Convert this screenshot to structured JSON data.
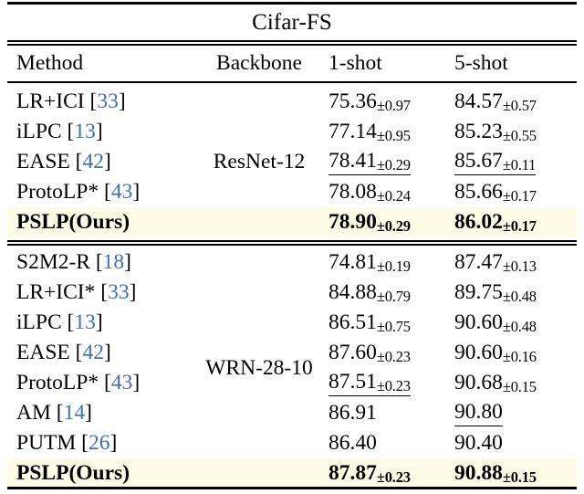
{
  "table": {
    "title": "Cifar-FS",
    "columns": {
      "method": "Method",
      "backbone": "Backbone",
      "one_shot": "1-shot",
      "five_shot": "5-shot"
    },
    "groups": [
      {
        "backbone": "ResNet-12",
        "rows": [
          {
            "method": "LR+ICI",
            "citation": "33",
            "one_shot": "75.36",
            "one_shot_pm": "±0.97",
            "five_shot": "84.57",
            "five_shot_pm": "±0.57",
            "bold": false,
            "highlight": false,
            "one_shot_underline": false,
            "five_shot_underline": false
          },
          {
            "method": "iLPC",
            "citation": "13",
            "one_shot": "77.14",
            "one_shot_pm": "±0.95",
            "five_shot": "85.23",
            "five_shot_pm": "±0.55",
            "bold": false,
            "highlight": false,
            "one_shot_underline": false,
            "five_shot_underline": false
          },
          {
            "method": "EASE",
            "citation": "42",
            "one_shot": "78.41",
            "one_shot_pm": "±0.29",
            "five_shot": "85.67",
            "five_shot_pm": "±0.11",
            "bold": false,
            "highlight": false,
            "one_shot_underline": true,
            "five_shot_underline": true
          },
          {
            "method": "ProtoLP*",
            "citation": "43",
            "one_shot": "78.08",
            "one_shot_pm": "±0.24",
            "five_shot": "85.66",
            "five_shot_pm": "±0.17",
            "bold": false,
            "highlight": false,
            "one_shot_underline": false,
            "five_shot_underline": false
          },
          {
            "method": "PSLP(Ours)",
            "citation": "",
            "one_shot": "78.90",
            "one_shot_pm": "±0.29",
            "five_shot": "86.02",
            "five_shot_pm": "±0.17",
            "bold": true,
            "highlight": true,
            "one_shot_underline": false,
            "five_shot_underline": false
          }
        ]
      },
      {
        "backbone": "WRN-28-10",
        "rows": [
          {
            "method": "S2M2-R",
            "citation": "18",
            "one_shot": "74.81",
            "one_shot_pm": "±0.19",
            "five_shot": "87.47",
            "five_shot_pm": "±0.13",
            "bold": false,
            "highlight": false,
            "one_shot_underline": false,
            "five_shot_underline": false
          },
          {
            "method": "LR+ICI*",
            "citation": "33",
            "one_shot": "84.88",
            "one_shot_pm": "±0.79",
            "five_shot": "89.75",
            "five_shot_pm": "±0.48",
            "bold": false,
            "highlight": false,
            "one_shot_underline": false,
            "five_shot_underline": false
          },
          {
            "method": "iLPC",
            "citation": "13",
            "one_shot": "86.51",
            "one_shot_pm": "±0.75",
            "five_shot": "90.60",
            "five_shot_pm": "±0.48",
            "bold": false,
            "highlight": false,
            "one_shot_underline": false,
            "five_shot_underline": false
          },
          {
            "method": "EASE",
            "citation": "42",
            "one_shot": "87.60",
            "one_shot_pm": "±0.23",
            "five_shot": "90.60",
            "five_shot_pm": "±0.16",
            "bold": false,
            "highlight": false,
            "one_shot_underline": false,
            "five_shot_underline": false
          },
          {
            "method": "ProtoLP*",
            "citation": "43",
            "one_shot": "87.51",
            "one_shot_pm": "±0.23",
            "five_shot": "90.68",
            "five_shot_pm": "±0.15",
            "bold": false,
            "highlight": false,
            "one_shot_underline": true,
            "five_shot_underline": false
          },
          {
            "method": "AM",
            "citation": "14",
            "one_shot": "86.91",
            "one_shot_pm": "",
            "five_shot": "90.80",
            "five_shot_pm": "",
            "bold": false,
            "highlight": false,
            "one_shot_underline": false,
            "five_shot_underline": true
          },
          {
            "method": "PUTM",
            "citation": "26",
            "one_shot": "86.40",
            "one_shot_pm": "",
            "five_shot": "90.40",
            "five_shot_pm": "",
            "bold": false,
            "highlight": false,
            "one_shot_underline": false,
            "five_shot_underline": false
          },
          {
            "method": "PSLP(Ours)",
            "citation": "",
            "one_shot": "87.87",
            "one_shot_pm": "±0.23",
            "five_shot": "90.88",
            "five_shot_pm": "±0.15",
            "bold": true,
            "highlight": true,
            "one_shot_underline": false,
            "five_shot_underline": false
          }
        ]
      }
    ],
    "colors": {
      "citation": "#3f6fb5",
      "highlight": "#fdfae6",
      "rule": "#000000"
    }
  }
}
